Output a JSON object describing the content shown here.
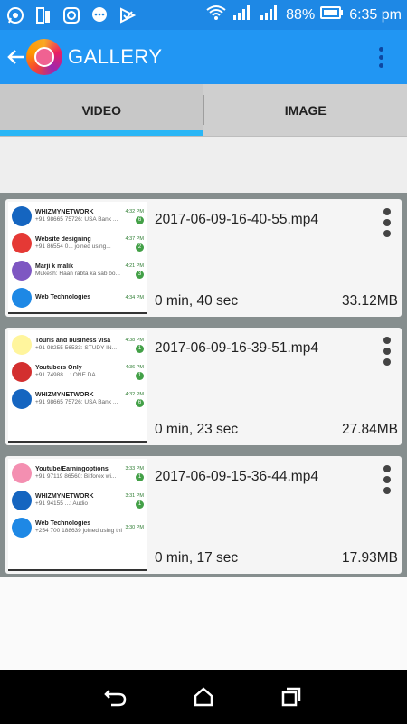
{
  "status_bar": {
    "battery": "88%",
    "time": "6:35 pm",
    "icons": [
      "whatsapp-icon",
      "phone-dual-icon",
      "instagram-icon",
      "chat-bubble-icon",
      "send-check-icon",
      "wifi-icon",
      "signal-icon",
      "signal-icon",
      "battery-icon"
    ]
  },
  "app_bar": {
    "title": "GALLERY"
  },
  "tabs": [
    {
      "label": "VIDEO",
      "active": true
    },
    {
      "label": "IMAGE",
      "active": false
    }
  ],
  "videos": [
    {
      "filename": "2017-06-09-16-40-55.mp4",
      "duration": "0 min, 40 sec",
      "size": "33.12MB",
      "thumb_rows": [
        {
          "name": "WHIZMYNETWORK",
          "msg": "+91 98665 75726: USA Bank ...",
          "time": "4:32 PM",
          "badge": "6",
          "avatar": "#1565c0"
        },
        {
          "name": "Website designing",
          "msg": "+91 86554 0... joined using...",
          "time": "4:37 PM",
          "badge": "2",
          "avatar": "#e53935"
        },
        {
          "name": "Marji k malik",
          "msg": "Mukesh: Haan rabta ka sab bo...",
          "time": "4:21 PM",
          "badge": "3",
          "avatar": "#7e57c2"
        },
        {
          "name": "Web Technologies",
          "msg": "",
          "time": "4:34 PM",
          "badge": "",
          "avatar": "#1e88e5"
        }
      ]
    },
    {
      "filename": "2017-06-09-16-39-51.mp4",
      "duration": "0 min, 23 sec",
      "size": "27.84MB",
      "thumb_rows": [
        {
          "name": "Touris and business visa",
          "msg": "+91 98255 56533: STUDY IN...",
          "time": "4:38 PM",
          "badge": "1",
          "avatar": "#fff59d"
        },
        {
          "name": "Youtubers Only",
          "msg": "+91 74988 ...: ONE DA...",
          "time": "4:36 PM",
          "badge": "1",
          "avatar": "#d32f2f"
        },
        {
          "name": "WHIZMYNETWORK",
          "msg": "+91 98665 75726: USA Bank ...",
          "time": "4:32 PM",
          "badge": "6",
          "avatar": "#1565c0"
        }
      ]
    },
    {
      "filename": "2017-06-09-15-36-44.mp4",
      "duration": "0 min, 17 sec",
      "size": "17.93MB",
      "thumb_rows": [
        {
          "name": "Youtube/Earningoptions",
          "msg": "+91 97119 86560: Bitforex wi...",
          "time": "3:33 PM",
          "badge": "1",
          "avatar": "#f48fb1"
        },
        {
          "name": "WHIZMYNETWORK",
          "msg": "+91 94155 ...: Audio",
          "time": "3:31 PM",
          "badge": "1",
          "avatar": "#1565c0"
        },
        {
          "name": "Web Technologies",
          "msg": "+254 700 188639 joined using thi...",
          "time": "3:30 PM",
          "badge": "",
          "avatar": "#1e88e5"
        }
      ]
    }
  ],
  "nav_bar": {
    "buttons": [
      "back-icon",
      "home-icon",
      "recents-icon"
    ]
  }
}
